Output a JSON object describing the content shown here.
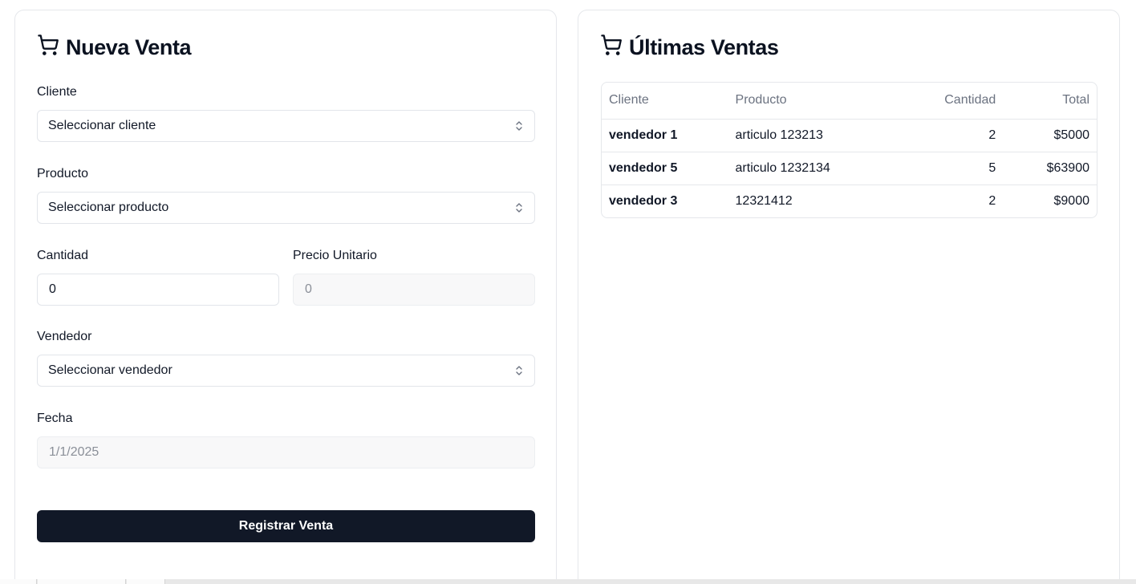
{
  "nueva_venta": {
    "title": "Nueva Venta",
    "title_icon": "cart-icon",
    "cliente": {
      "label": "Cliente",
      "value": "Seleccionar cliente"
    },
    "producto": {
      "label": "Producto",
      "value": "Seleccionar producto"
    },
    "cantidad": {
      "label": "Cantidad",
      "value": "0"
    },
    "precio_unitario": {
      "label": "Precio Unitario",
      "value": "0"
    },
    "vendedor": {
      "label": "Vendedor",
      "value": "Seleccionar vendedor"
    },
    "fecha": {
      "label": "Fecha",
      "value": "1/1/2025"
    },
    "submit_label": "Registrar Venta"
  },
  "ultimas_ventas": {
    "title": "Últimas Ventas",
    "title_icon": "cart-icon",
    "columns": [
      "Cliente",
      "Producto",
      "Cantidad",
      "Total"
    ],
    "rows": [
      {
        "cliente": "vendedor 1",
        "producto": "articulo 123213",
        "cantidad": "2",
        "total": "$5000"
      },
      {
        "cliente": "vendedor 5",
        "producto": "articulo 1232134",
        "cantidad": "5",
        "total": "$63900"
      },
      {
        "cliente": "vendedor 3",
        "producto": "12321412",
        "cantidad": "2",
        "total": "$9000"
      }
    ]
  },
  "colors": {
    "primary_button": "#111827",
    "border": "#e5e7eb",
    "muted_text": "#6b7280"
  }
}
